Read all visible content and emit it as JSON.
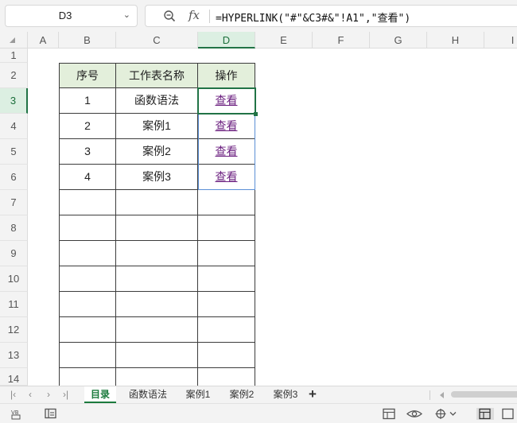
{
  "formula_bar": {
    "name_box": "D3",
    "fx_symbol": "fx",
    "formula": "=HYPERLINK(\"#\"&C3#&\"!A1\",\"查看\")"
  },
  "columns": [
    "A",
    "B",
    "C",
    "D",
    "E",
    "F",
    "G",
    "H",
    "I"
  ],
  "rows": [
    "1",
    "2",
    "3",
    "4",
    "5",
    "6",
    "7",
    "8",
    "9",
    "10",
    "11",
    "12",
    "13",
    "14"
  ],
  "selected_cell": {
    "column": "D",
    "row": "3"
  },
  "table": {
    "headers": [
      "序号",
      "工作表名称",
      "操作"
    ],
    "rows": [
      {
        "no": "1",
        "name": "函数语法",
        "action": "查看"
      },
      {
        "no": "2",
        "name": "案例1",
        "action": "查看"
      },
      {
        "no": "3",
        "name": "案例2",
        "action": "查看"
      },
      {
        "no": "4",
        "name": "案例3",
        "action": "查看"
      }
    ]
  },
  "sheet_tabs": [
    "目录",
    "函数语法",
    "案例1",
    "案例2",
    "案例3"
  ],
  "active_tab": "目录",
  "add_tab": "+",
  "colors": {
    "accent": "#217346",
    "header_fill": "#e3efdb",
    "link": "#6b1f7f",
    "active_tab": "#1b7a3d"
  }
}
